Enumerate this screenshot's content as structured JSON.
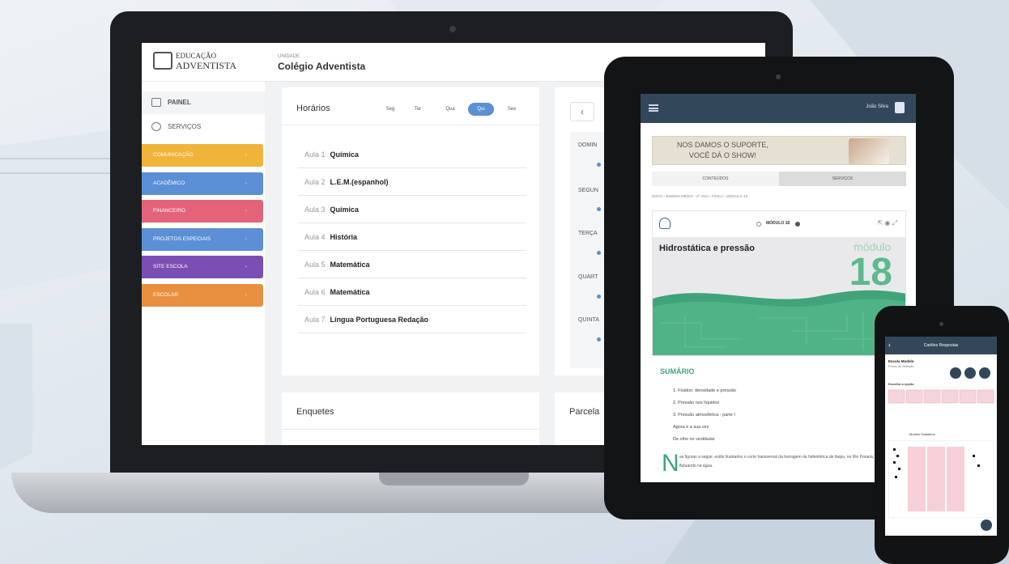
{
  "laptop": {
    "logo_line1": "EDUCAÇÃO",
    "logo_line2": "ADVENTISTA",
    "school_small": "UNIDADE",
    "school_name": "Colégio Adventista",
    "sidebar": {
      "painel": "PAINEL",
      "servicos": "SERVIÇOS",
      "colored": [
        {
          "label": "COMUNICAÇÃO",
          "color": "#f0b43a"
        },
        {
          "label": "ACADÊMICO",
          "color": "#5b8fd6"
        },
        {
          "label": "FINANCEIRO",
          "color": "#e2637a"
        },
        {
          "label": "PROJETOS ESPECIAIS",
          "color": "#5b8fd6"
        },
        {
          "label": "SITE ESCOLA",
          "color": "#7a4fb4"
        },
        {
          "label": "ESCOLAR",
          "color": "#e89040"
        }
      ]
    },
    "horarios": {
      "title": "Horários",
      "days": [
        "Seg",
        "Ter",
        "Qua",
        "Qui",
        "Sex"
      ],
      "active_day": "Qui",
      "rows": [
        {
          "num": "Aula 1",
          "subject": "Química"
        },
        {
          "num": "Aula 2",
          "subject": "L.E.M.(espanhol)"
        },
        {
          "num": "Aula 3",
          "subject": "Química"
        },
        {
          "num": "Aula 4",
          "subject": "História"
        },
        {
          "num": "Aula 5",
          "subject": "Matemática"
        },
        {
          "num": "Aula 6",
          "subject": "Matemática"
        },
        {
          "num": "Aula 7",
          "subject": "Língua Portuguesa Redação"
        }
      ]
    },
    "week_strip": {
      "back": "‹",
      "labels": [
        "DOMIN",
        "SEGUN",
        "TERÇA",
        "QUART",
        "QUINTA"
      ]
    },
    "enquetes": "Enquetes",
    "parcelas": "Parcela"
  },
  "tablet": {
    "user": "João Silva",
    "banner_line1": "NOS DAMOS O SUPORTE,",
    "banner_line2": "VOCÊ DÁ O SHOW!",
    "tabs": [
      "CONTEÚDOS",
      "SERVIÇOS"
    ],
    "breadcrumb": "INÍCIO  ›  ENSINO MÉDIO  ›  2º ANO  ›  FÍSICA  ›  MÓDULO 18",
    "module_nav": "MÓDULO 18",
    "module_title": "Hidrostática e pressão",
    "module_word": "módulo",
    "module_number": "18",
    "sumario": "SUMÁRIO",
    "sumario_items": [
      "1. Fluidos: densidade e pressão",
      "2. Pressão nos líquidos",
      "3. Pressão atmosférica - parte I",
      "Agora é a sua vez",
      "De olho no vestibular"
    ],
    "drop_cap": "N",
    "body_text": "as figuras a seguir, estão ilustrados o corte transversal da barragem da hidrelétrica de Itaipu, no Rio Paraná, e uma bola flutuando na água."
  },
  "phone": {
    "header": "Cartões Respostas",
    "student_name": "Escola Modelo",
    "student_sub": "Prova de Seleção",
    "section_label": "Escolha a opção",
    "sheet_title": "Modelo Gabaritos"
  }
}
